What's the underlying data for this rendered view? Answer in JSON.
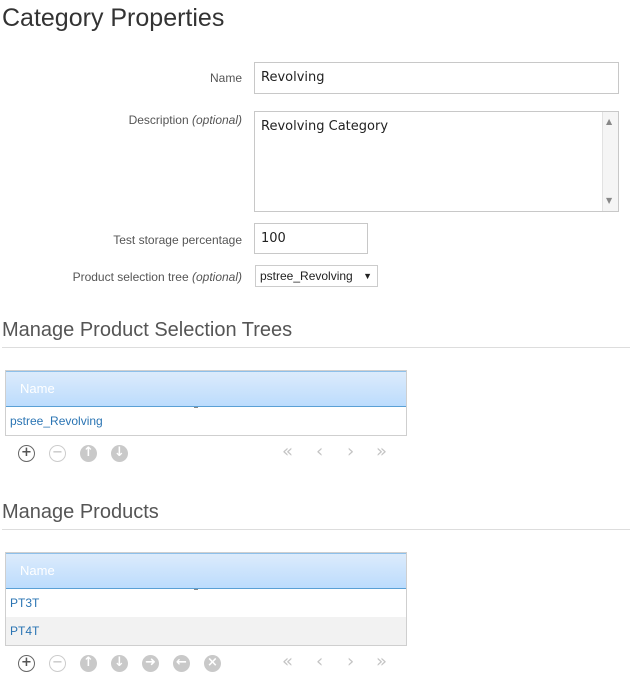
{
  "page": {
    "title": "Category Properties"
  },
  "form": {
    "name_label": "Name",
    "name_value": "Revolving",
    "description_label": "Description",
    "description_optional": "(optional)",
    "description_value": "Revolving Category",
    "storage_label": "Test storage percentage",
    "storage_value": "100",
    "tree_label": "Product selection tree",
    "tree_optional": "(optional)",
    "tree_selected": "pstree_Revolving"
  },
  "trees_section": {
    "title": "Manage Product Selection Trees",
    "column": "Name",
    "rows": [
      "pstree_Revolving"
    ]
  },
  "products_section": {
    "title": "Manage Products",
    "column": "Name",
    "rows": [
      "PT3T",
      "PT4T"
    ]
  },
  "icons": {
    "add": "plus-circle-icon",
    "remove": "minus-circle-icon",
    "up": "arrow-up-circle-icon",
    "down": "arrow-down-circle-icon",
    "forward": "forward-circle-icon",
    "back": "back-circle-icon",
    "delete": "x-circle-icon",
    "first": "double-left-icon",
    "prev": "left-icon",
    "next": "right-icon",
    "last": "double-right-icon"
  },
  "colors": {
    "link": "#2a74b3",
    "header_blue": "#bcdcfd"
  }
}
